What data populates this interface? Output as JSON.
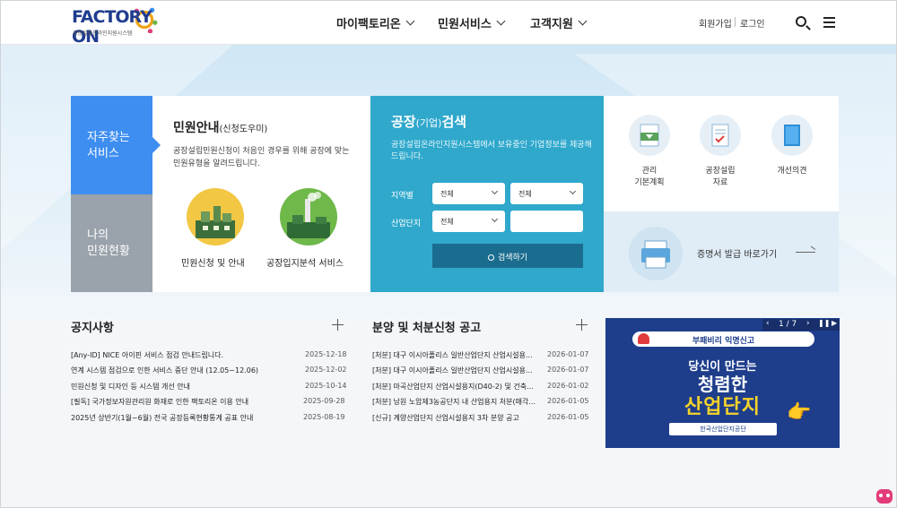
{
  "header": {
    "logo": "FACTORY ON",
    "logo_sub": "공장설립온라인지원시스템",
    "nav": [
      "마이팩토리온",
      "민원서비스",
      "고객지원"
    ],
    "util": {
      "join": "회원가입",
      "login": "로그인"
    }
  },
  "service": {
    "tab_active": "자주찾는\n서비스",
    "tab_inactive": "나의\n민원현황",
    "title": "민원안내",
    "title_sub": "(신청도우미)",
    "desc": "공장설립민원신청이 처음인 경우를 위해 공장에 맞는 민원유형을 알려드립니다.",
    "items": [
      {
        "label": "민원신청 및 안내",
        "icon": "factory-building-icon"
      },
      {
        "label": "공장입지분석 서비스",
        "icon": "factory-chimney-icon"
      }
    ]
  },
  "search": {
    "title": "공장",
    "title_sub": "(기업)",
    "title_end": "검색",
    "desc": "공장설립온라인지원시스템에서 보유중인 기업정보를 제공해드립니다.",
    "region_label": "지역별",
    "region_select1": "전체",
    "region_select2": "전체",
    "complex_label": "산업단지",
    "complex_select": "전체",
    "complex_input": "",
    "button": "검색하기"
  },
  "quick": {
    "items": [
      {
        "label": "관리\n기본계획",
        "icon": "document-plan-icon"
      },
      {
        "label": "공장설립\n자료",
        "icon": "document-check-icon"
      },
      {
        "label": "개선의견",
        "icon": "book-icon"
      }
    ],
    "cert_label": "증명서 발급 바로가기",
    "cert_icon": "printer-icon"
  },
  "notice": {
    "title": "공지사항",
    "rows": [
      {
        "title": "[Any-ID] NICE 아이핀 서비스 점검 안내드립니다.",
        "date": "2025-12-18"
      },
      {
        "title": "연계 시스템 점검으로 인한 서비스 중단 안내 (12.05~12.06)",
        "date": "2025-12-02"
      },
      {
        "title": "민원신청 및 디자인 등 시스템 개선 안내",
        "date": "2025-10-14"
      },
      {
        "title": "[필독] 국가정보자원관리원 화재로 인한 팩토리온 이용 안내",
        "date": "2025-09-28"
      },
      {
        "title": "2025년 상반기(1월~6월) 전국 공장등록현황통계 공표 안내",
        "date": "2025-08-19"
      }
    ]
  },
  "sale": {
    "title": "분양 및 처분신청 공고",
    "rows": [
      {
        "title": "[처분] 대구 이시아폴리스 일반산업단지 산업시설용...",
        "date": "2026-01-07"
      },
      {
        "title": "[처분] 대구 이시아폴리스 일반산업단지 산업시설용...",
        "date": "2026-01-07"
      },
      {
        "title": "[처분] 마곡산업단지 산업시설용지(D40-2) 및 건축...",
        "date": "2026-01-02"
      },
      {
        "title": "[처분] 남원 노암제3농공단지 내 산업용지 처분(매각...",
        "date": "2026-01-05"
      },
      {
        "title": "[신규] 계양산업단지 산업시설용지 3차 분양 공고",
        "date": "2026-01-05"
      }
    ]
  },
  "banner": {
    "pager": "1 / 7",
    "pill": "부패비리 익명신고",
    "line1": "당신이 만드는",
    "line2": "청렴한",
    "line3": "산업단지",
    "footer": "한국산업단지공단"
  }
}
